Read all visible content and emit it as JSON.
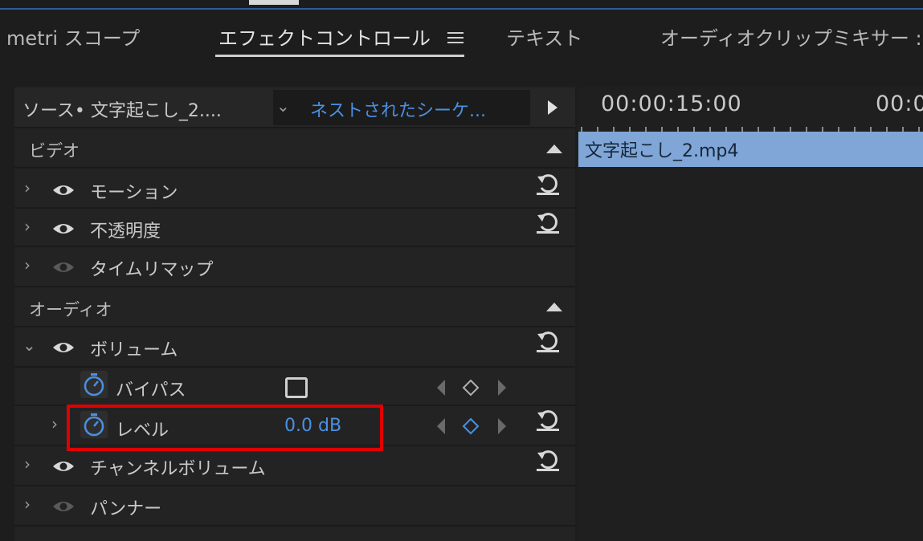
{
  "tabs": [
    {
      "label": "metri スコープ"
    },
    {
      "label": "エフェクトコントロール"
    },
    {
      "label": "テキスト"
    },
    {
      "label": "オーディオクリップミキサー :"
    }
  ],
  "source": {
    "label": "ソース• 文字起こし_2....",
    "sequence": "ネストされたシーケ..."
  },
  "timeline": {
    "timecode_1": "00:00:15:00",
    "timecode_2": "00:0",
    "clip_name": "文字起こし_2.mp4"
  },
  "sections": {
    "video": "ビデオ",
    "audio": "オーディオ"
  },
  "effects": {
    "motion": "モーション",
    "opacity": "不透明度",
    "time_remap": "タイムリマップ",
    "volume": "ボリューム",
    "bypass": "バイパス",
    "level": "レベル",
    "level_value": "0.0 dB",
    "channel_volume": "チャンネルボリューム",
    "panner": "パンナー"
  },
  "colors": {
    "accent": "#4a90e2",
    "clip": "#7fa6d6",
    "highlight": "#e00000"
  }
}
